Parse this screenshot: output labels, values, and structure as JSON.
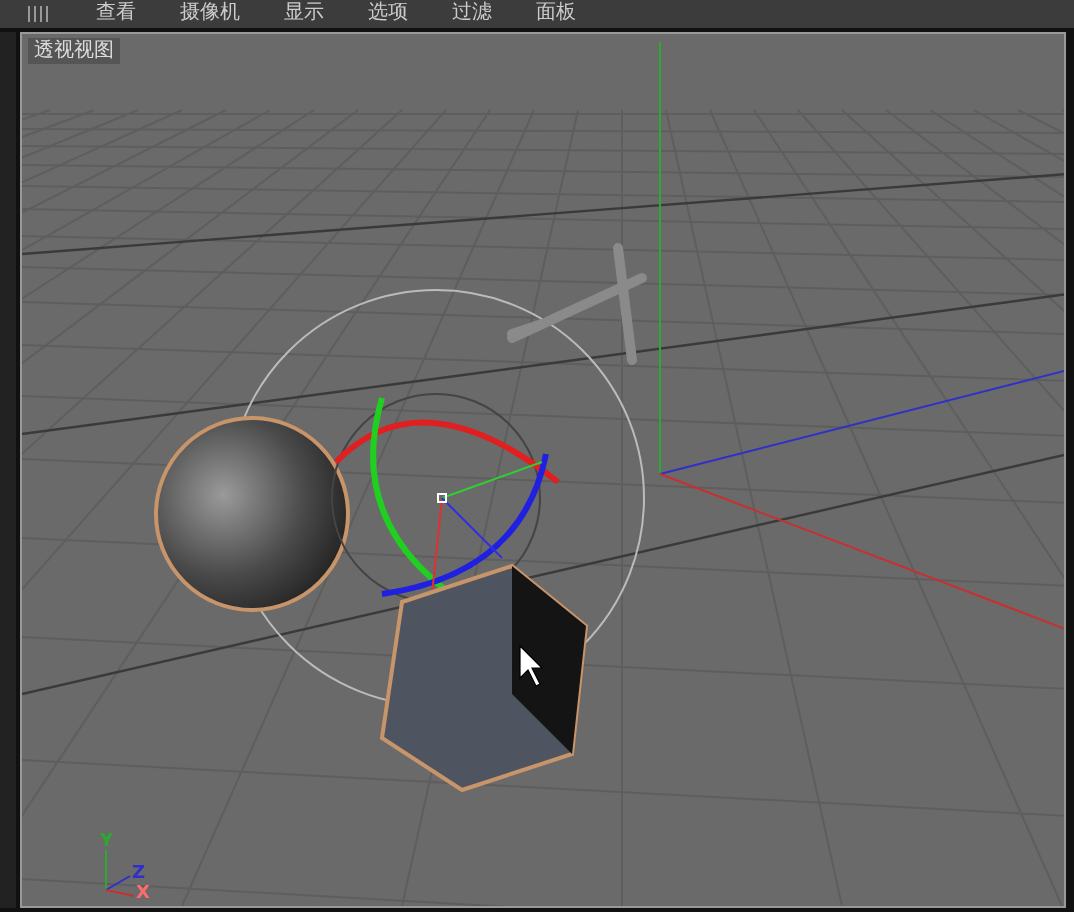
{
  "menu": [
    "查看",
    "摄像机",
    "显示",
    "选项",
    "过滤",
    "面板"
  ],
  "viewport": {
    "label": "透视视图",
    "axis_labels": [
      {
        "kind": "y",
        "text": "Y"
      },
      {
        "kind": "z",
        "text": "Z"
      },
      {
        "kind": "x",
        "text": "X"
      }
    ]
  }
}
